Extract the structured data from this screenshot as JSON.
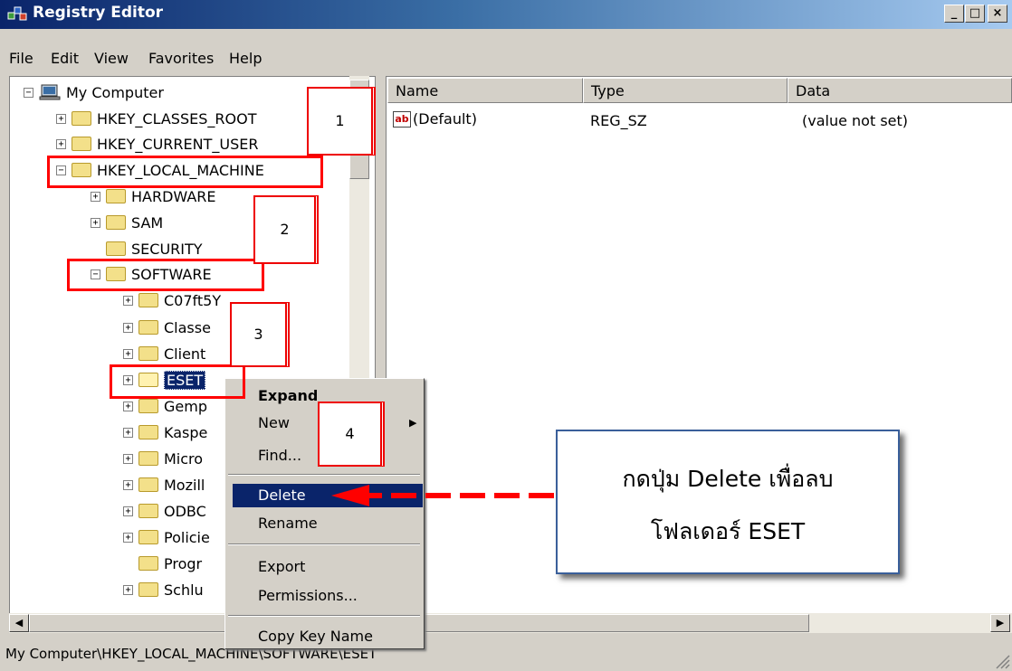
{
  "window": {
    "title": "Registry Editor",
    "min": "_",
    "max": "□",
    "close": "×"
  },
  "menu": [
    "File",
    "Edit",
    "View",
    "Favorites",
    "Help"
  ],
  "tree": {
    "root": "My Computer",
    "level1": [
      "HKEY_CLASSES_ROOT",
      "HKEY_CURRENT_USER",
      "HKEY_LOCAL_MACHINE"
    ],
    "level2": [
      "HARDWARE",
      "SAM",
      "SECURITY",
      "SOFTWARE"
    ],
    "level3": [
      "C07ft5Y",
      "Classe",
      "Client",
      "ESET",
      "Gemp",
      "Kaspe",
      "Micro",
      "Mozill",
      "ODBC",
      "Policie",
      "Progr",
      "Schlu"
    ]
  },
  "list": {
    "columns": [
      "Name",
      "Type",
      "Data"
    ],
    "rows": [
      {
        "name": "(Default)",
        "type": "REG_SZ",
        "data": "(value not set)"
      }
    ]
  },
  "context_menu": {
    "items": [
      "Expand",
      "New",
      "Find...",
      "Delete",
      "Rename",
      "Export",
      "Permissions...",
      "Copy Key Name"
    ]
  },
  "status": "My Computer\\HKEY_LOCAL_MACHINE\\SOFTWARE\\ESET",
  "annotations": {
    "steps": [
      "1",
      "2",
      "3",
      "4"
    ],
    "callout": {
      "line1": "กดปุ่ม Delete เพื่อลบ",
      "line2": "โฟลเดอร์ ESET"
    },
    "color": "#ff0000"
  }
}
